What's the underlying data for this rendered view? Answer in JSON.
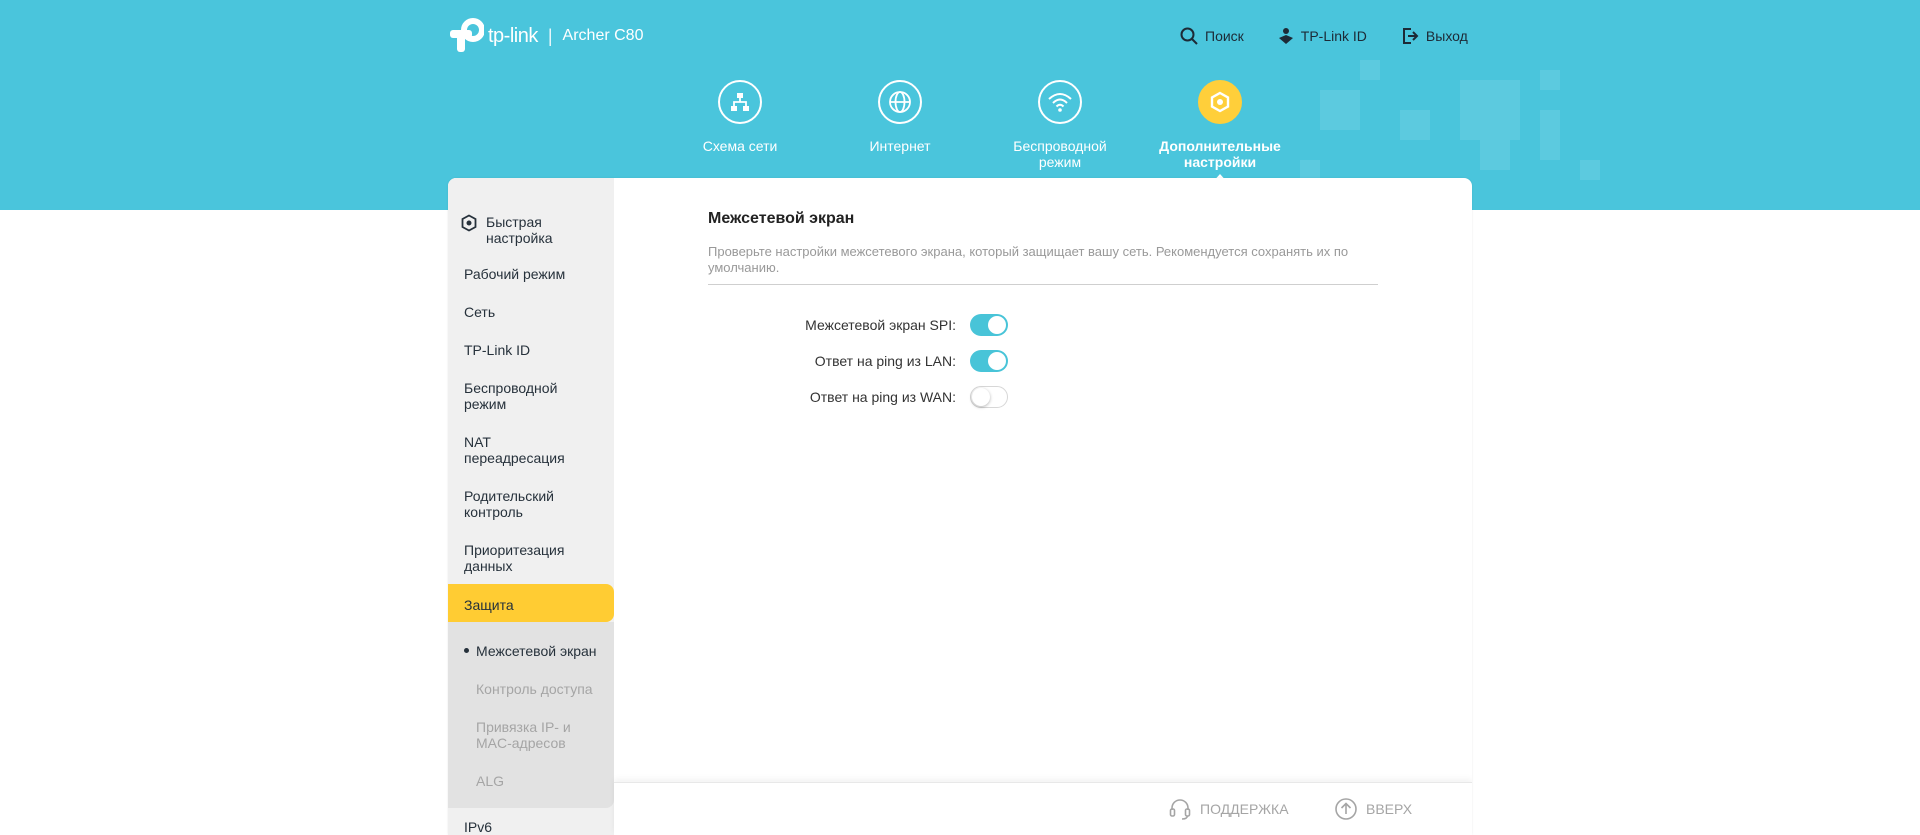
{
  "brand": {
    "logo_text": "tp-link",
    "separator": "|",
    "model": "Archer C80"
  },
  "top_nav": {
    "search": "Поиск",
    "tplink_id": "TP-Link ID",
    "logout": "Выход"
  },
  "tabs": [
    {
      "label": "Схема сети",
      "icon": "network-map-icon"
    },
    {
      "label": "Интернет",
      "icon": "globe-icon"
    },
    {
      "label": "Беспроводной режим",
      "icon": "wifi-icon"
    },
    {
      "label": "Дополнительные настройки",
      "icon": "gear-icon",
      "active": true
    }
  ],
  "sidebar": {
    "quick_setup": "Быстрая настройка",
    "items": [
      "Рабочий режим",
      "Сеть",
      "TP-Link ID",
      "Беспроводной режим",
      "NAT переадресация",
      "Родительский контроль",
      "Приоритезация данных"
    ],
    "active": "Защита",
    "sub_items": [
      "Межсетевой экран",
      "Контроль доступа",
      "Привязка IP- и MAC-адресов",
      "ALG"
    ],
    "after": "IPv6"
  },
  "content": {
    "title": "Межсетевой экран",
    "description": "Проверьте настройки межсетевого экрана, который защищает вашу сеть. Рекомендуется сохранять их по умолчанию.",
    "settings": [
      {
        "label": "Межсетевой экран SPI:",
        "on": true
      },
      {
        "label": "Ответ на ping из LAN:",
        "on": true
      },
      {
        "label": "Ответ на ping из WAN:",
        "on": false
      }
    ]
  },
  "footer": {
    "support": "ПОДДЕРЖКА",
    "top": "ВВЕРХ"
  },
  "colors": {
    "header_bg": "#4ac5dc",
    "accent_yellow": "#ffcc33",
    "toggle_on": "#48c4d8"
  }
}
